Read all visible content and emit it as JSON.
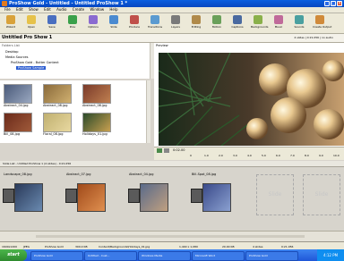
{
  "window": {
    "title": "ProShow Gold - Untitled - Untitled ProShow 1 *"
  },
  "menu": [
    "File",
    "Edit",
    "Show",
    "Edit",
    "Audio",
    "Create",
    "Window",
    "Help"
  ],
  "toolbar": [
    {
      "label": "Wizard",
      "icon": "wizard-icon",
      "color": "#d9a23a"
    },
    {
      "label": "Open",
      "icon": "folder-icon",
      "color": "#e6c24a"
    },
    {
      "label": "Save",
      "icon": "save-icon",
      "color": "#4a6fc0"
    },
    {
      "label": "Prev",
      "icon": "play-icon",
      "color": "#3aa04a"
    },
    {
      "label": "Options",
      "icon": "options-icon",
      "color": "#8a6ad0"
    },
    {
      "label": "Slide",
      "icon": "slide-icon",
      "color": "#4a8ad0"
    },
    {
      "label": "Produce",
      "icon": "produce-icon",
      "color": "#c0504a"
    },
    {
      "label": "Transitions",
      "icon": "transitions-icon",
      "color": "#5a9ad0"
    },
    {
      "label": "Layers",
      "icon": "layers-icon",
      "color": "#7a7a7a"
    },
    {
      "label": "Editing",
      "icon": "editing-icon",
      "color": "#b08a4a"
    },
    {
      "label": "Motion",
      "icon": "motion-icon",
      "color": "#6aa05a"
    },
    {
      "label": "Captions",
      "icon": "captions-icon",
      "color": "#4a6aa0"
    },
    {
      "label": "Backgrounds",
      "icon": "background-icon",
      "color": "#8ab04a"
    },
    {
      "label": "Music",
      "icon": "music-icon",
      "color": "#c06a9a"
    },
    {
      "label": "Sounds",
      "icon": "sounds-icon",
      "color": "#4aa0a0"
    },
    {
      "label": "Create Output",
      "icon": "output-icon",
      "color": "#d08a3a"
    }
  ],
  "show": {
    "title": "Untitled Pro Show 1",
    "info": "4 slides | 0:21.056 | no audio"
  },
  "folders": {
    "label": "Folders List",
    "items": [
      "Desktop",
      "Media Sources",
      "ProShow Gold - Butter Content",
      "ProShow Sample"
    ]
  },
  "files": [
    {
      "name": "Abstract_04.jpg",
      "colors": [
        "#4a5a7a",
        "#9aa8c0"
      ]
    },
    {
      "name": "Abstract_08.jpg",
      "colors": [
        "#8a6a3a",
        "#d0b070"
      ]
    },
    {
      "name": "Abstract_08.jpg",
      "colors": [
        "#7a3a2a",
        "#c08050"
      ]
    },
    {
      "name": "Bill_08.jpg",
      "colors": [
        "#6a2a1a",
        "#a05a3a"
      ]
    },
    {
      "name": "Floral_08.jpg",
      "colors": [
        "#c0b070",
        "#e8d8a0"
      ]
    },
    {
      "name": "Holidays_01.jpg",
      "colors": [
        "#2a4a2a",
        "#c8a050"
      ]
    }
  ],
  "preview": {
    "label": "Preview",
    "time": "0:02.00",
    "ruler": [
      "0",
      "1.0",
      "2.0",
      "3.0",
      "4.0",
      "5.0",
      "6.0",
      "7.0",
      "8.0",
      "9.0",
      "10.0"
    ]
  },
  "slide_list_label": "Slide List - Untitled ProShow 1 (4 slides) - 0:21.056",
  "slides": [
    {
      "num": "1",
      "name": "Landscape_08.jpg",
      "colors": [
        "#2a3a5a",
        "#6a8ab0"
      ]
    },
    {
      "num": "2",
      "name": "Abstract_07.jpg",
      "colors": [
        "#a04a1a",
        "#e09050"
      ]
    },
    {
      "num": "3",
      "name": "Abstract_04.jpg",
      "colors": [
        "#5a6a8a",
        "#c0a080"
      ]
    },
    {
      "num": "4",
      "name": "Bill-Spot_08.jpg",
      "colors": [
        "#3a4a8a",
        "#8aa0d0"
      ]
    }
  ],
  "empty_slide": "Slide",
  "status": [
    "1600x1200",
    "JPEG",
    "ProShow Gold",
    "300.0 KB",
    "Content\\Backgrounds\\Holidays_01.jpg",
    "1,440 x 1,080",
    "20.00 KB",
    "4 slides",
    "0:21.056"
  ],
  "taskbar": {
    "start": "start",
    "tasks": [
      "ProShow Gold",
      "Untitled - Cust...",
      "Windows Media",
      "Microsoft Word",
      "ProShow Gold"
    ],
    "clock": "4:12 PM"
  }
}
